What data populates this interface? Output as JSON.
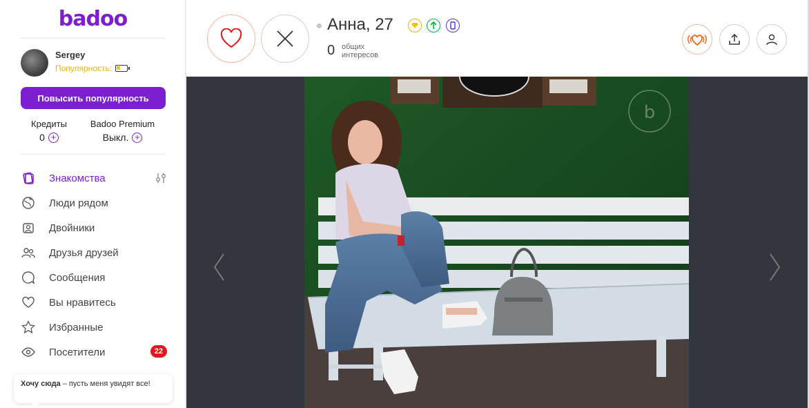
{
  "sidebar": {
    "logo": "badoo",
    "user": {
      "name": "Sergey",
      "popularity_label": "Популярность:"
    },
    "boost_button": "Повысить популярность",
    "credits": {
      "label": "Кредиты",
      "value": "0"
    },
    "premium": {
      "label": "Badoo Premium",
      "value": "Выкл."
    },
    "nav": [
      {
        "label": "Знакомства",
        "icon": "cards-icon"
      },
      {
        "label": "Люди рядом",
        "icon": "globe-icon"
      },
      {
        "label": "Двойники",
        "icon": "lookalikes-icon"
      },
      {
        "label": "Друзья друзей",
        "icon": "friends-icon"
      },
      {
        "label": "Сообщения",
        "icon": "chat-icon"
      },
      {
        "label": "Вы нравитесь",
        "icon": "heart-icon"
      },
      {
        "label": "Избранные",
        "icon": "star-icon"
      },
      {
        "label": "Посетители",
        "icon": "eye-icon",
        "badge": "22"
      }
    ],
    "tooltip": {
      "bold": "Хочу сюда",
      "text": " – пусть меня увидят все!"
    }
  },
  "profile": {
    "name_age": "Анна, 27",
    "interests_count": "0",
    "interests_label_1": "общих",
    "interests_label_2": "интересов"
  },
  "colors": {
    "accent": "#7b1fd1",
    "like": "#e0171b",
    "badge": "#e0171b",
    "popularity": "#f0b400"
  }
}
